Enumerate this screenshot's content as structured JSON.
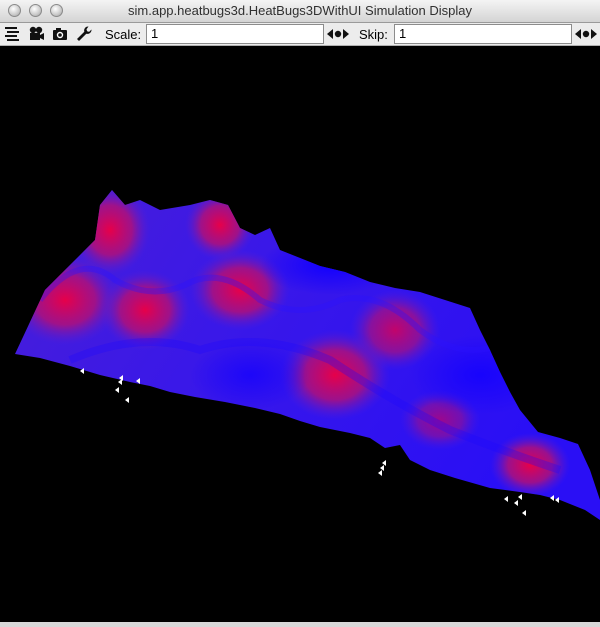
{
  "window": {
    "title": "sim.app.heatbugs3d.HeatBugs3DWithUI Simulation Display"
  },
  "toolbar": {
    "icons": [
      "layers-icon",
      "movie-camera-icon",
      "camera-icon",
      "wrench-icon"
    ],
    "scale_label": "Scale:",
    "scale_value": "1",
    "skip_label": "Skip:",
    "skip_value": "1"
  },
  "display": {
    "background": "#000000",
    "surface_colors": {
      "high": "#e6004a",
      "low": "#1000ff"
    },
    "bug_color": "#ffffff"
  }
}
